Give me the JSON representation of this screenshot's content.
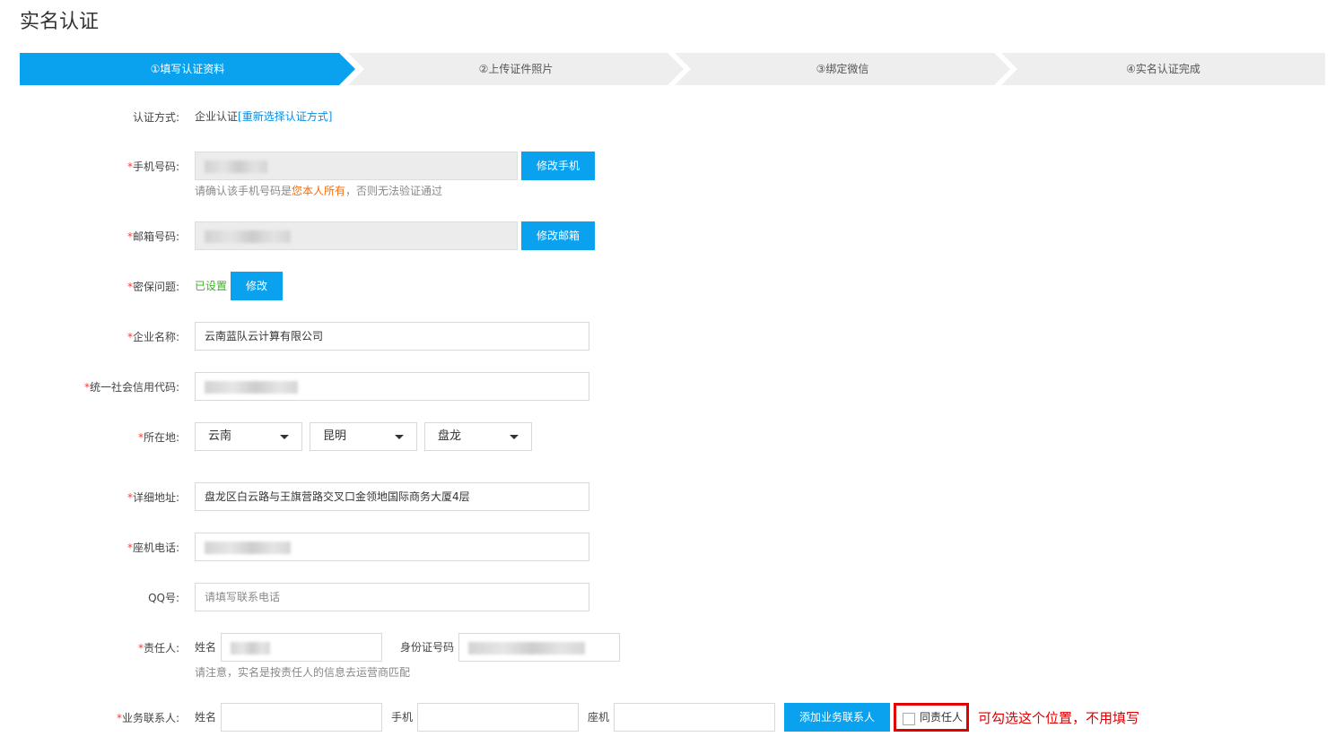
{
  "page": {
    "title": "实名认证"
  },
  "steps": [
    {
      "label": "①填写认证资料",
      "active": true
    },
    {
      "label": "②上传证件照片",
      "active": false
    },
    {
      "label": "③绑定微信",
      "active": false
    },
    {
      "label": "④实名认证完成",
      "active": false
    }
  ],
  "colors": {
    "accent": "#0aa2ef",
    "required": "#ff3b30",
    "warning": "#ff6a00",
    "annotation": "#e00000",
    "success": "#3fae29"
  },
  "form": {
    "auth_method": {
      "label": "认证方式:",
      "value": "企业认证",
      "link": "[重新选择认证方式]"
    },
    "phone": {
      "required": "*",
      "label": "手机号码:",
      "button": "修改手机",
      "hint_prefix": "请确认该手机号码是",
      "hint_highlight": "您本人所有",
      "hint_suffix": "，否则无法验证通过"
    },
    "email": {
      "required": "*",
      "label": "邮箱号码:",
      "button": "修改邮箱"
    },
    "security_question": {
      "required": "*",
      "label": "密保问题:",
      "status": "已设置",
      "button": "修改"
    },
    "company_name": {
      "required": "*",
      "label": "企业名称:",
      "value": "云南蓝队云计算有限公司"
    },
    "credit_code": {
      "required": "*",
      "label": "统一社会信用代码:"
    },
    "location": {
      "required": "*",
      "label": "所在地:",
      "province": "云南",
      "city": "昆明",
      "district": "盘龙"
    },
    "address": {
      "required": "*",
      "label": "详细地址:",
      "value": "盘龙区白云路与王旗营路交叉口金领地国际商务大厦4层"
    },
    "landline": {
      "required": "*",
      "label": "座机电话:"
    },
    "qq": {
      "label": "QQ号:",
      "placeholder": "请填写联系电话"
    },
    "responsible": {
      "required": "*",
      "label": "责任人:",
      "name_label": "姓名",
      "id_label": "身份证号码",
      "hint": "请注意，实名是按责任人的信息去运营商匹配"
    },
    "business_contact": {
      "required": "*",
      "label": "业务联系人:",
      "name_label": "姓名",
      "mobile_label": "手机",
      "landline_label": "座机",
      "add_button": "添加业务联系人",
      "same_checkbox_label": "同责任人"
    }
  },
  "annotation": "可勾选这个位置，不用填写"
}
